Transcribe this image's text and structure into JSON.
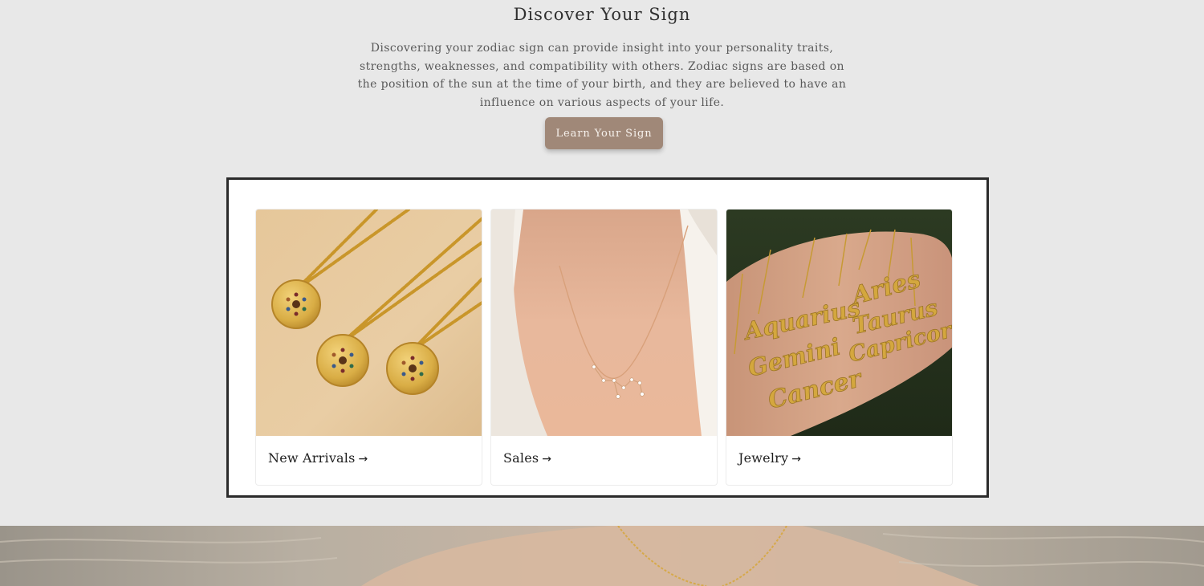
{
  "hero": {
    "title": "Discover Your Sign",
    "description": "Discovering your zodiac sign can provide insight into your personality traits, strengths, weaknesses, and compatibility with others. Zodiac signs are based on the position of the sun at the time of your birth, and they are believed to have an influence on various aspects of your life.",
    "button_label": "Learn Your Sign"
  },
  "collections": [
    {
      "label": "New Arrivals",
      "arrow": "→",
      "image": "gold-coin-pendant-necklaces-on-sand"
    },
    {
      "label": "Sales",
      "arrow": "→",
      "image": "constellation-necklace-on-neck"
    },
    {
      "label": "Jewelry",
      "arrow": "→",
      "image": "zodiac-name-necklaces-in-hand"
    }
  ],
  "name_necklaces": [
    "Aries",
    "Aquarius",
    "Taurus",
    "Gemini",
    "Capricorn",
    "Cancer"
  ],
  "colors": {
    "page_background": "#e8e8e8",
    "button": "#a08878",
    "frame_border": "#2b2b2b"
  }
}
